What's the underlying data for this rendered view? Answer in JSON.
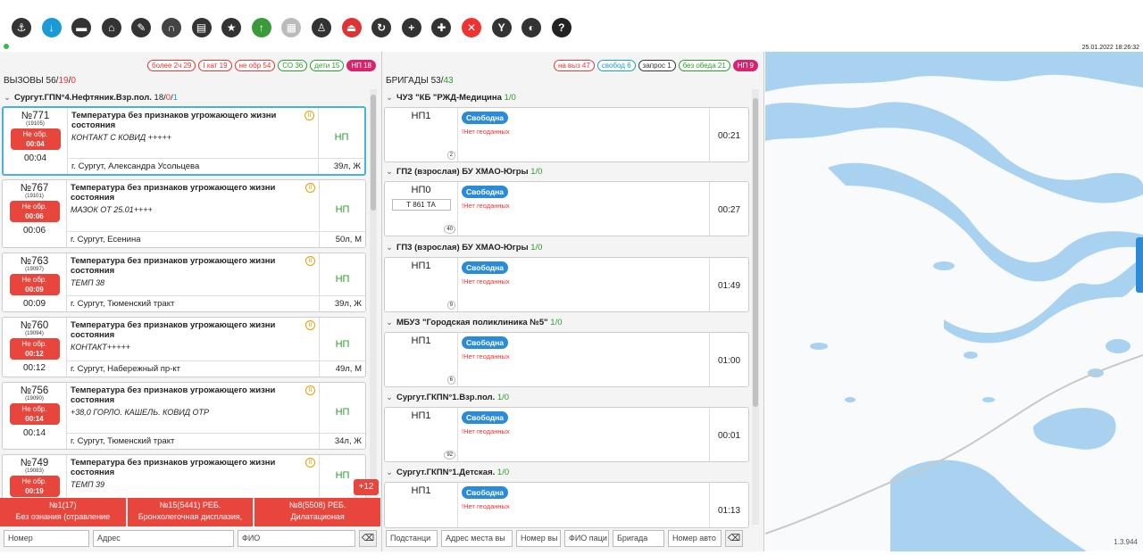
{
  "toolbar": {
    "icons": [
      {
        "name": "anchor-icon",
        "color": "#333"
      },
      {
        "name": "download-icon",
        "color": "#1a9ad6"
      },
      {
        "name": "ambulance-icon",
        "color": "#333"
      },
      {
        "name": "home-icon",
        "color": "#333"
      },
      {
        "name": "edit-icon",
        "color": "#333"
      },
      {
        "name": "arch-icon",
        "color": "#444"
      },
      {
        "name": "print-icon",
        "color": "#333"
      },
      {
        "name": "star-icon",
        "color": "#333"
      },
      {
        "name": "upload-icon",
        "color": "#3a9a3a"
      },
      {
        "name": "document-icon",
        "color": "#bbb"
      },
      {
        "name": "person-desk-icon",
        "color": "#333"
      },
      {
        "name": "eject-icon",
        "color": "#d33"
      },
      {
        "name": "refresh-icon",
        "color": "#333"
      },
      {
        "name": "add-circle-icon",
        "color": "#333"
      },
      {
        "name": "chat-add-icon",
        "color": "#333"
      },
      {
        "name": "close-circle-icon",
        "color": "#e33"
      },
      {
        "name": "fork-icon",
        "color": "#333"
      },
      {
        "name": "globe-icon",
        "color": "#333"
      },
      {
        "name": "help-icon",
        "color": "#222"
      }
    ],
    "datetime": "25.01.2022 18:26:32"
  },
  "calls": {
    "title": "ВЫЗОВЫ",
    "count_total": "56",
    "count_red": "19",
    "count_extra": "0",
    "badges": [
      {
        "label": "более 2ч 29",
        "color": "#e33"
      },
      {
        "label": "I кат 19",
        "color": "#e33"
      },
      {
        "label": "не обр 54",
        "color": "#e33"
      },
      {
        "label": "СО 36",
        "color": "#2a9d2a"
      },
      {
        "label": "дети 15",
        "color": "#2a9d2a"
      },
      {
        "label": "НП 18",
        "color": "#d6246e",
        "fill": true
      }
    ],
    "group": {
      "name": "Сургут.ГПN°4.Нефтяник.Взр.пол.",
      "count": "18",
      "red": "0",
      "blue": "1"
    },
    "items": [
      {
        "num": "№771",
        "id": "(19105)",
        "status": "Не обр.",
        "status_time": "00:04",
        "time": "00:04",
        "title": "Температура без признаков угрожающего жизни состояния",
        "note": "КОНТАКТ С КОВИД +++++",
        "addr": "г. Сургут, Александра Усольцева",
        "np": "НП",
        "age": "39л, Ж"
      },
      {
        "num": "№767",
        "id": "(19101)",
        "status": "Не обр.",
        "status_time": "00:06",
        "time": "00:06",
        "title": "Температура без признаков угрожающего жизни состояния",
        "note": "МАЗОК ОТ 25.01++++",
        "addr": "г. Сургут, Есенина",
        "np": "НП",
        "age": "50л, М"
      },
      {
        "num": "№763",
        "id": "(19097)",
        "status": "Не обр.",
        "status_time": "00:09",
        "time": "00:09",
        "title": "Температура без признаков угрожающего жизни состояния",
        "note": "ТЕМП 38",
        "addr": "г. Сургут, Тюменский тракт",
        "np": "НП",
        "age": "39л, Ж"
      },
      {
        "num": "№760",
        "id": "(19094)",
        "status": "Не обр.",
        "status_time": "00:12",
        "time": "00:12",
        "title": "Температура без признаков угрожающего жизни состояния",
        "note": "КОНТАКТ+++++",
        "addr": "г. Сургут, Набережный пр-кт",
        "np": "НП",
        "age": "49л, М"
      },
      {
        "num": "№756",
        "id": "(19090)",
        "status": "Не обр.",
        "status_time": "00:14",
        "time": "00:14",
        "title": "Температура без признаков угрожающего жизни состояния",
        "note": "+38,0 ГОРЛО. КАШЕЛЬ. КОВИД ОТР",
        "addr": "г. Сургут, Тюменский тракт",
        "np": "НП",
        "age": "34л, Ж"
      },
      {
        "num": "№749",
        "id": "(19083)",
        "status": "Не обр.",
        "status_time": "00:19",
        "time": "",
        "title": "Температура без признаков угрожающего жизни состояния",
        "note": "ТЕМП 39",
        "addr": "",
        "np": "НП",
        "age": ""
      }
    ],
    "more": "+12",
    "red_bar": [
      {
        "line1": "№1(17)",
        "line2": "Без ознания (отравление"
      },
      {
        "line1": "№15(5441) РЕБ.",
        "line2": "Бронхолегочная дисплазия,"
      },
      {
        "line1": "№8(5508) РЕБ.",
        "line2": "Дилатационая"
      }
    ],
    "filters": [
      "Номер",
      "Адрес",
      "ФИО"
    ]
  },
  "brigades": {
    "title": "БРИГАДЫ",
    "count_total": "53",
    "count_green": "43",
    "badges": [
      {
        "label": "на выз 47",
        "color": "#e33"
      },
      {
        "label": "свобод 6",
        "color": "#1a9ad6"
      },
      {
        "label": "запрос 1",
        "color": "#333"
      },
      {
        "label": "без обеда 21",
        "color": "#2a9d2a"
      },
      {
        "label": "НП 9",
        "color": "#d6246e",
        "fill": true
      }
    ],
    "groups": [
      {
        "name": "ЧУЗ \"КБ \"РЖД-Медицина",
        "count": "1/0",
        "np": "НП1",
        "plate": "",
        "mini": "2",
        "status": "Свободна",
        "geo": "Нет геоданных",
        "time": "00:21"
      },
      {
        "name": "ГП2 (взрослая) БУ ХМАО-Югры",
        "count": "1/0",
        "np": "НП0",
        "plate": "Т 861 ТА",
        "mini": "40",
        "status": "Свободна",
        "geo": "Нет геоданных",
        "time": "00:27"
      },
      {
        "name": "ГП3 (взрослая) БУ ХМАО-Югры",
        "count": "1/0",
        "np": "НП1",
        "plate": "",
        "mini": "9",
        "status": "Свободна",
        "geo": "Нет геоданных",
        "time": "01:49"
      },
      {
        "name": "МБУЗ \"Городская поликлиника №5\"",
        "count": "1/0",
        "np": "НП1",
        "plate": "",
        "mini": "6",
        "status": "Свободна",
        "geo": "Нет геоданных",
        "time": "01:00"
      },
      {
        "name": "Сургут.ГКПN°1.Взр.пол.",
        "count": "1/0",
        "np": "НП1",
        "plate": "",
        "mini": "92",
        "status": "Свободна",
        "geo": "Нет геоданных",
        "time": "00:01"
      },
      {
        "name": "Сургут.ГКПN°1.Детская.",
        "count": "1/0",
        "np": "НП1",
        "plate": "",
        "mini": "",
        "status": "Свободна",
        "geo": "Нет геоданных",
        "time": "01:13"
      }
    ],
    "filters": [
      "Подстанци",
      "Адрес места вы",
      "Номер вы",
      "ФИО паци",
      "Бригада",
      "Номер авто"
    ]
  },
  "map": {
    "version": "1.3.944",
    "water_color": "#a9d2f0",
    "land_color": "#f9fafb"
  }
}
